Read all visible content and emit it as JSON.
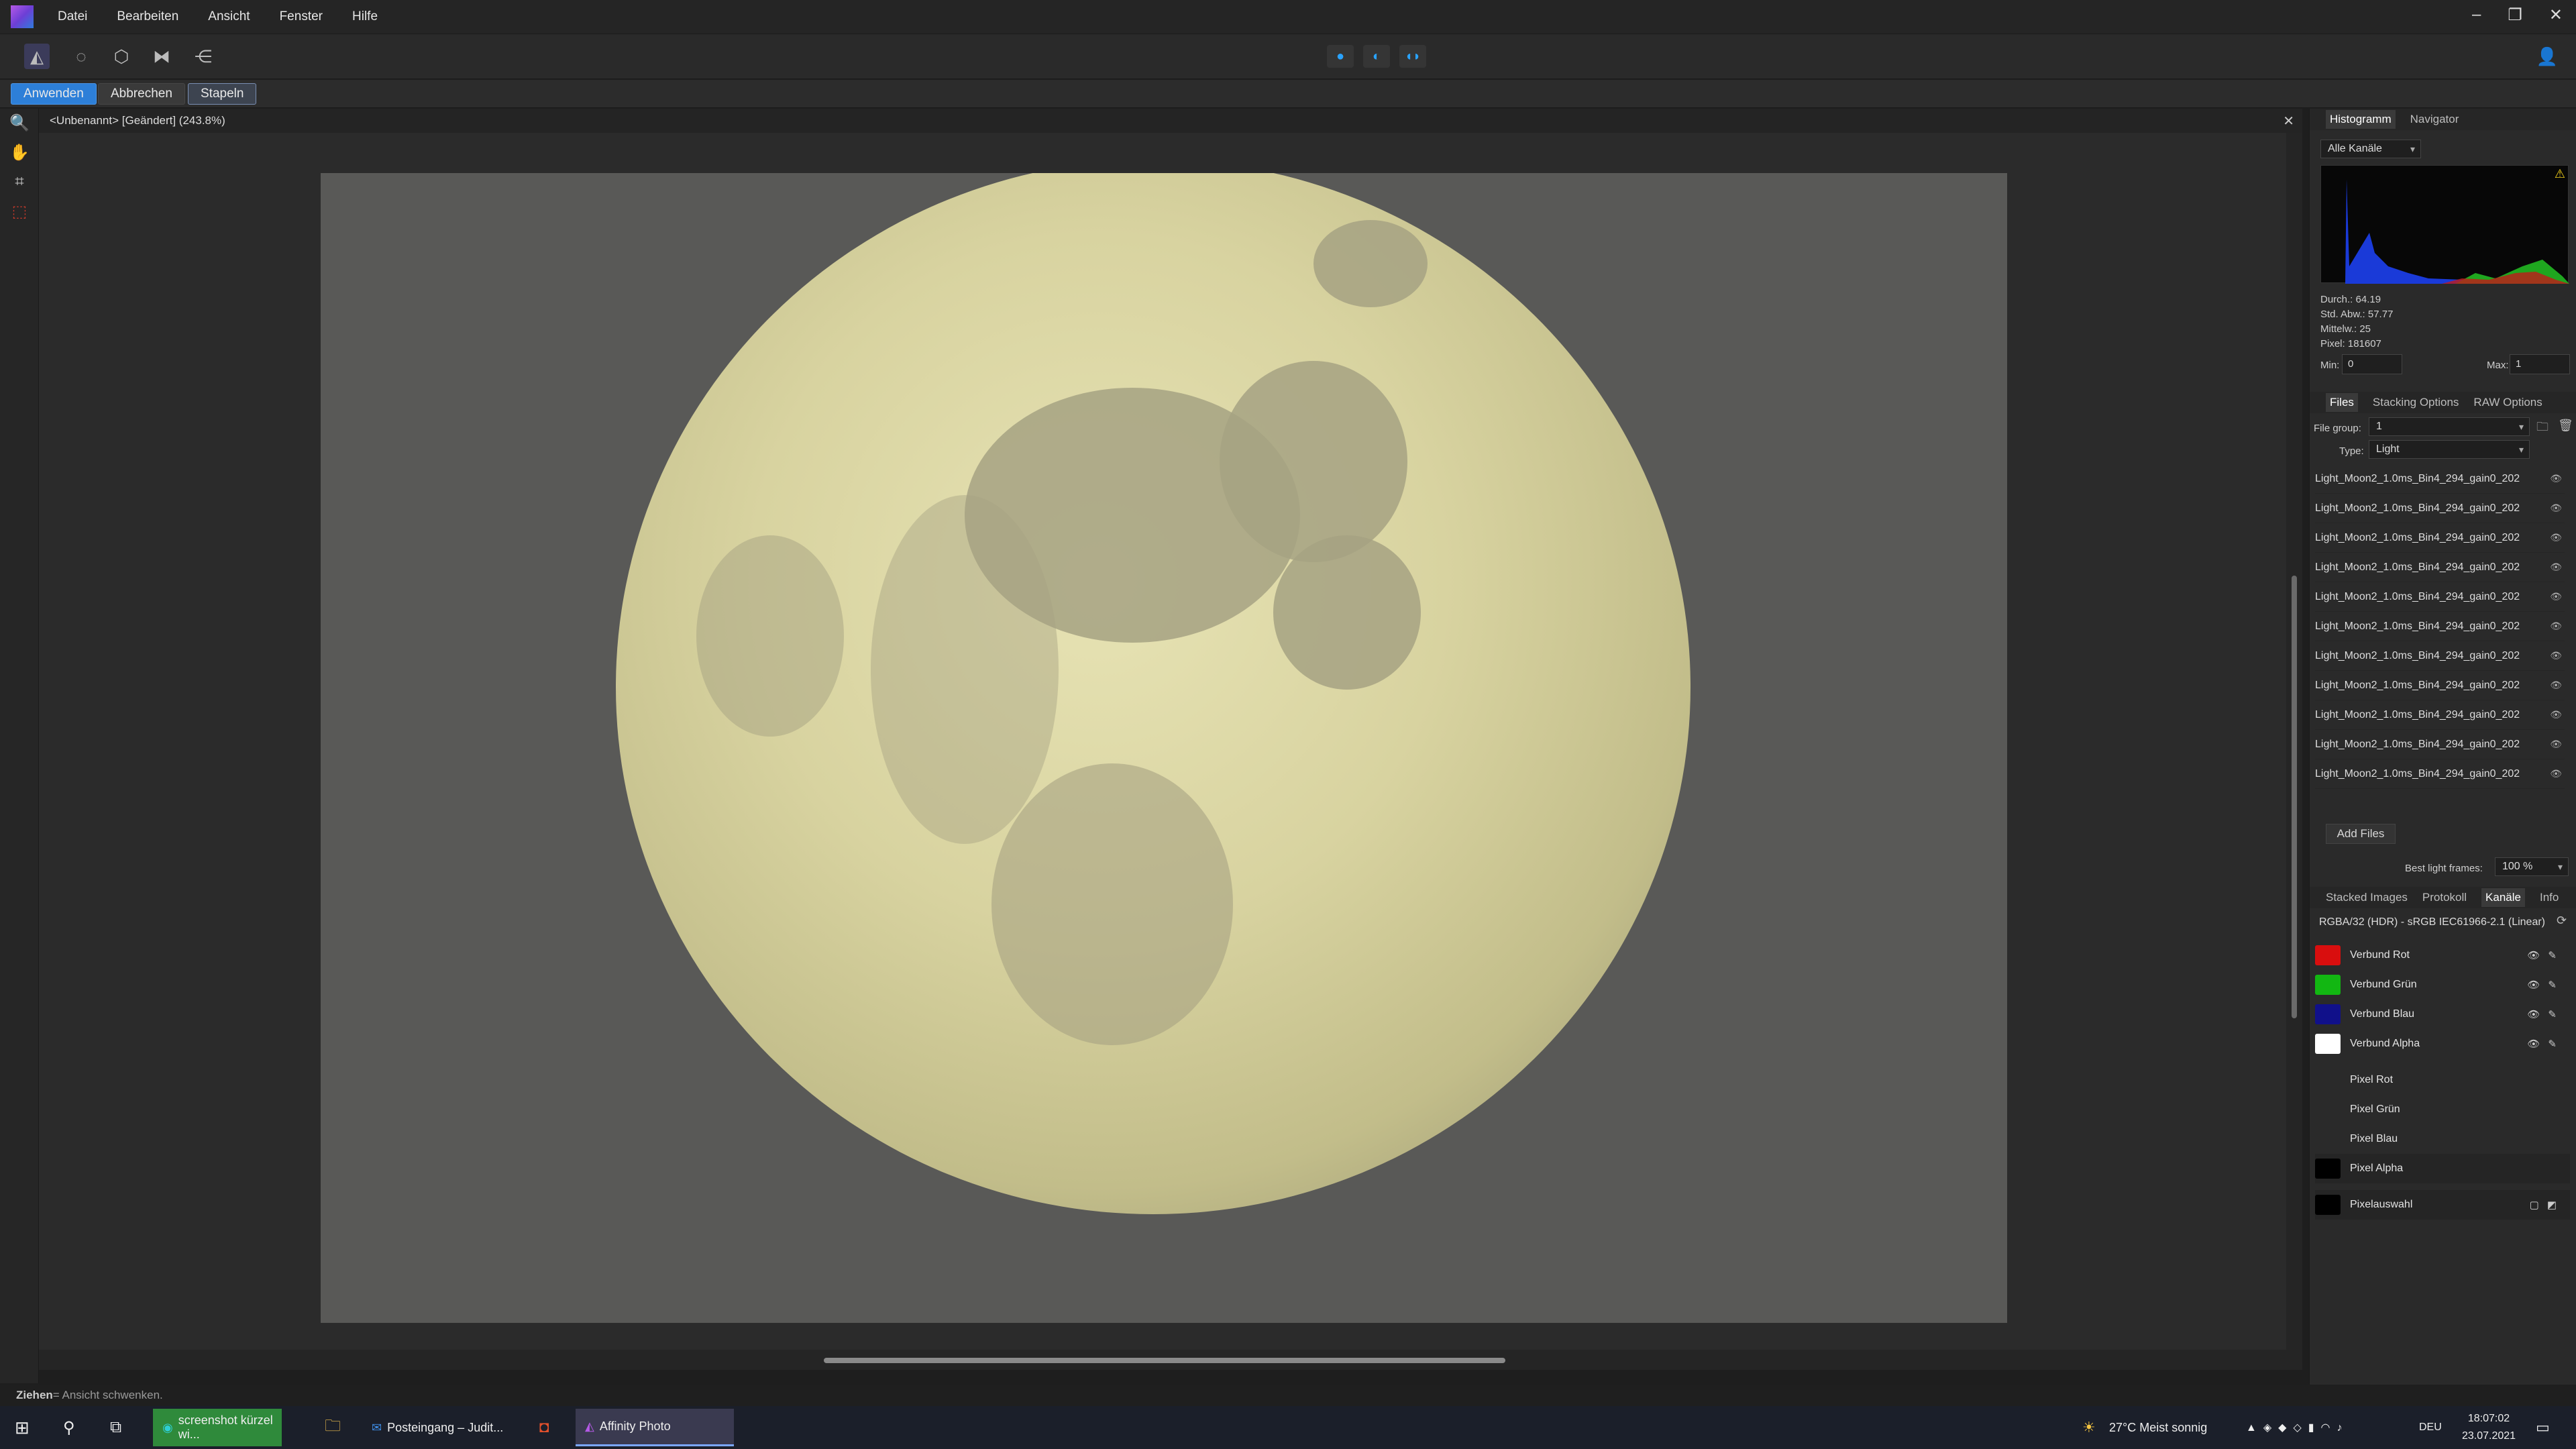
{
  "menu": {
    "items": [
      "Datei",
      "Bearbeiten",
      "Ansicht",
      "Fenster",
      "Hilfe"
    ]
  },
  "window": {
    "minimize_icon": "minimize-icon",
    "maximize_icon": "restore-icon",
    "close_icon": "close-icon"
  },
  "context": {
    "apply": "Anwenden",
    "cancel": "Abbrechen",
    "stack": "Stapeln"
  },
  "document": {
    "title": "<Unbenannt> [Geändert] (243.8%)"
  },
  "histogram": {
    "tabs": [
      "Histogramm",
      "Navigator"
    ],
    "channel": "Alle Kanäle",
    "stats": [
      "Durch.: 64.19",
      "Std. Abw.: 57.77",
      "Mittelw.: 25",
      "Pixel: 181607"
    ],
    "min_label": "Min:",
    "min_value": "0",
    "max_label": "Max:",
    "max_value": "1"
  },
  "stack_panel": {
    "tabs": [
      "Files",
      "Stacking Options",
      "RAW Options"
    ],
    "file_group_label": "File group:",
    "file_group_value": "1",
    "type_label": "Type:",
    "type_value": "Light",
    "file_name": "Light_Moon2_1.0ms_Bin4_294_gain0_202",
    "add_files": "Add Files",
    "best_frames_label": "Best light frames:",
    "best_frames_value": "100 %"
  },
  "channels_panel": {
    "tabs": [
      "Stacked Images",
      "Protokoll",
      "Kanäle",
      "Info"
    ],
    "format": "RGBA/32 (HDR) - sRGB IEC61966-2.1 (Linear)",
    "composite": [
      {
        "label": "Verbund Rot",
        "color": "#e01010"
      },
      {
        "label": "Verbund Grün",
        "color": "#10c010"
      },
      {
        "label": "Verbund Blau",
        "color": "#10108a"
      },
      {
        "label": "Verbund Alpha",
        "color": "#ffffff"
      }
    ],
    "pixel": [
      "Pixel Rot",
      "Pixel Grün",
      "Pixel Blau",
      "Pixel Alpha"
    ],
    "selection": "Pixelauswahl"
  },
  "status": {
    "action": "Ziehen",
    "hint": " = Ansicht schwenken."
  },
  "taskbar": {
    "tasks": [
      "screenshot kürzel wi...",
      "Posteingang – Judit...",
      "Affinity Photo"
    ],
    "weather": "27°C  Meist sonnig",
    "lang": "DEU",
    "time": "18:07:02",
    "date": "23.07.2021"
  },
  "colors": {
    "accent": "#2d7fd8",
    "histogram_blue": "#1a3ad8",
    "histogram_green": "#1fa61f",
    "histogram_red": "#c21a1a"
  }
}
